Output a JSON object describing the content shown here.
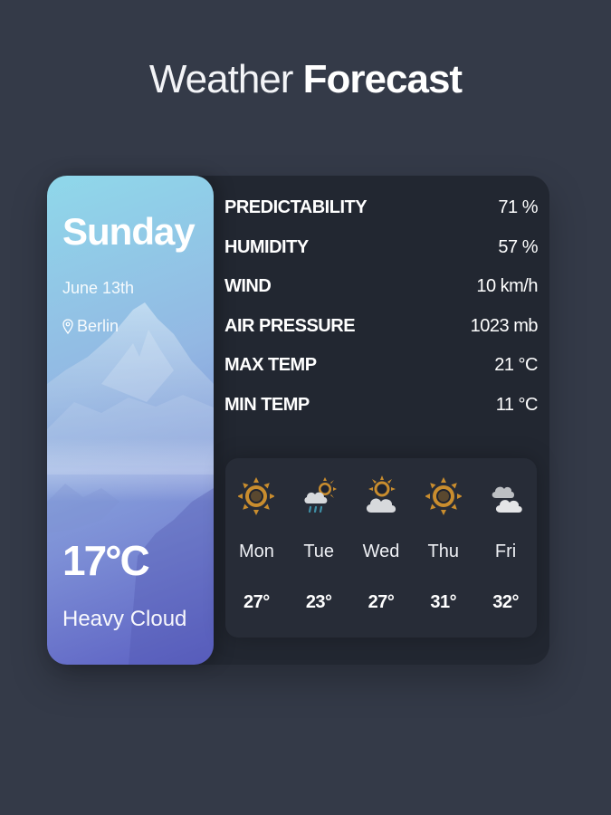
{
  "title": {
    "light": "Weather",
    "bold": "Forecast"
  },
  "current": {
    "day": "Sunday",
    "date": "June 13th",
    "location": "Berlin",
    "temperature": "17°C",
    "condition": "Heavy Cloud",
    "location_icon": "map-pin-icon"
  },
  "stats": [
    {
      "label": "PREDICTABILITY",
      "value": "71 %"
    },
    {
      "label": "HUMIDITY",
      "value": "57 %"
    },
    {
      "label": "WIND",
      "value": "10 km/h"
    },
    {
      "label": "AIR PRESSURE",
      "value": "1023 mb"
    },
    {
      "label": "MAX TEMP",
      "value": "21 °C"
    },
    {
      "label": "MIN TEMP",
      "value": "11 °C"
    }
  ],
  "forecast": [
    {
      "day": "Mon",
      "temp": "27°",
      "icon": "sun-icon"
    },
    {
      "day": "Tue",
      "temp": "23°",
      "icon": "rain-cloud-sun-icon"
    },
    {
      "day": "Wed",
      "temp": "27°",
      "icon": "partly-cloudy-icon"
    },
    {
      "day": "Thu",
      "temp": "31°",
      "icon": "sun-icon"
    },
    {
      "day": "Fri",
      "temp": "32°",
      "icon": "cloudy-icon"
    }
  ],
  "colors": {
    "background": "#343a48",
    "card": "#222731",
    "sun": "#c98d2e",
    "cloud": "#d7d9dc",
    "rain": "#3f8fa6"
  }
}
